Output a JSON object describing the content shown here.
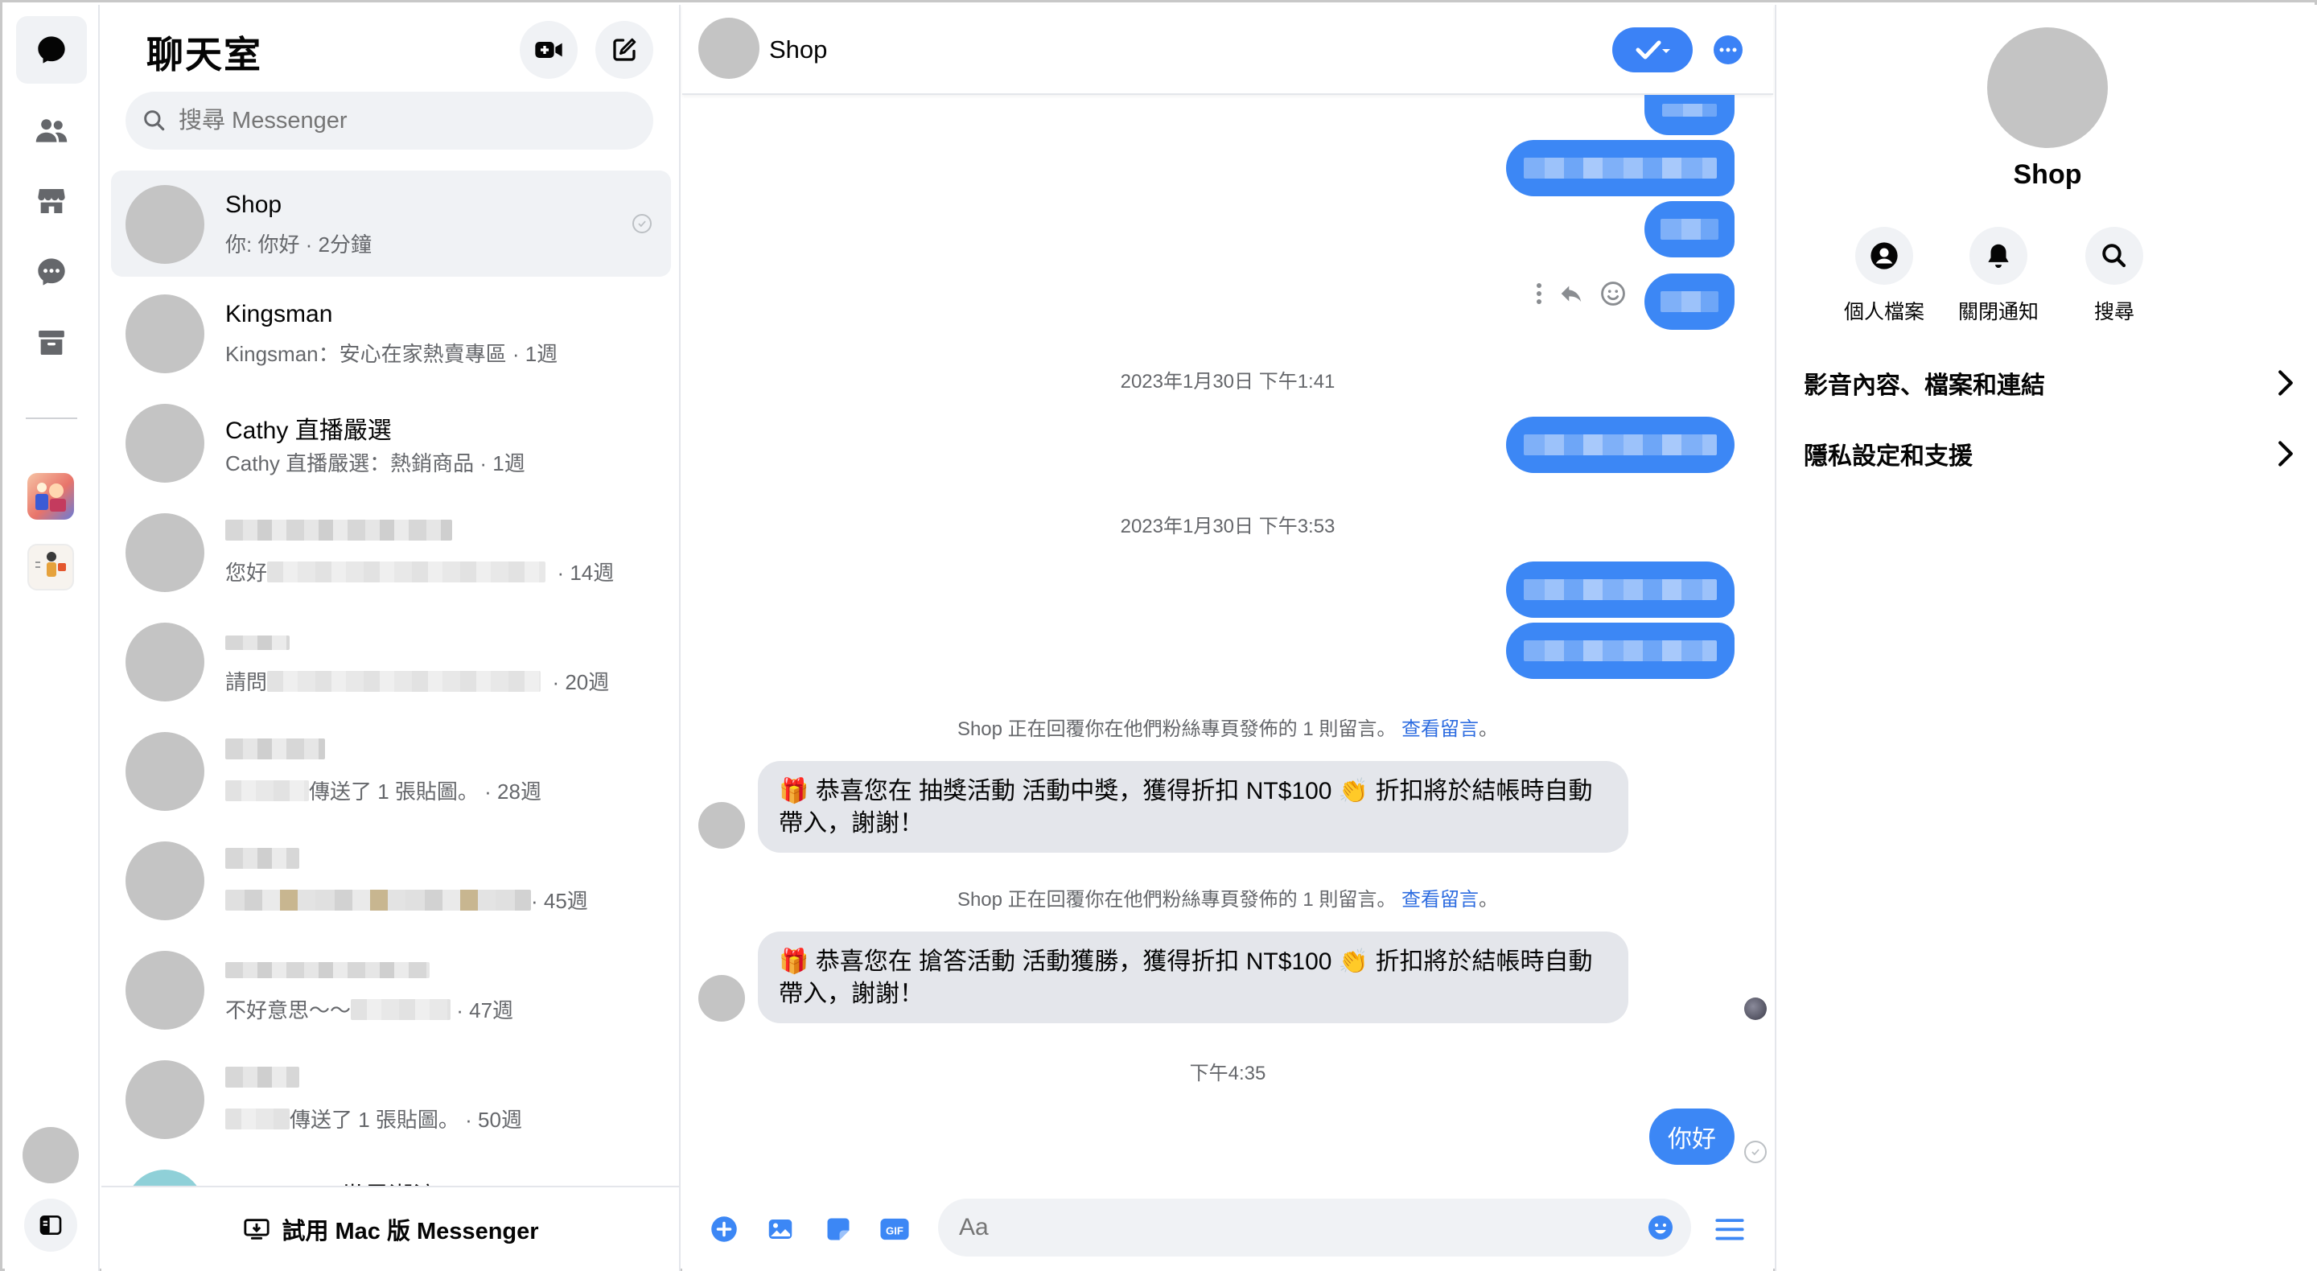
{
  "rail": {
    "items": [
      {
        "name": "chats",
        "icon": "chat-bubble-icon",
        "active": true
      },
      {
        "name": "people",
        "icon": "people-icon"
      },
      {
        "name": "marketplace",
        "icon": "store-icon"
      },
      {
        "name": "requests",
        "icon": "message-dots-icon"
      },
      {
        "name": "archive",
        "icon": "archive-icon"
      }
    ]
  },
  "chatlist": {
    "title": "聊天室",
    "search_placeholder": "搜尋 Messenger",
    "items": [
      {
        "name": "Shop",
        "preview": "你: 你好 · 2分鐘",
        "selected": true
      },
      {
        "name": "Kingsman",
        "preview": "Kingsman：安心在家熱賣專區 · 1週"
      },
      {
        "name": "Cathy 直播嚴選",
        "preview": "Cathy 直播嚴選：熱銷商品 · 1週"
      },
      {
        "preview_prefix": "您好",
        "time": "· 14週"
      },
      {
        "preview_prefix": "請問",
        "time": "· 20週"
      },
      {
        "preview_prefix": "傳送了 1 張貼圖。",
        "time": "· 28週"
      },
      {
        "preview_prefix": "",
        "time": "· 45週"
      },
      {
        "preview_prefix": "不好意思～～",
        "time": "· 47週"
      },
      {
        "preview_prefix": "傳送了 1 張貼圖。",
        "time": "· 50週"
      },
      {
        "name": "Shopline · 世界潮流"
      }
    ],
    "footer": "試用 Mac 版 Messenger"
  },
  "conversation": {
    "name": "Shop",
    "timestamps": [
      "2023年1月30日 下午1:41",
      "2023年1月30日 下午3:53",
      "下午4:35"
    ],
    "system_messages": [
      {
        "text": "Shop 正在回覆你在他們粉絲專頁發佈的 1 則留言。",
        "link": "查看留言",
        "period": "。"
      },
      {
        "text": "Shop 正在回覆你在他們粉絲專頁發佈的 1 則留言。",
        "link": "查看留言",
        "period": "。"
      }
    ],
    "incoming": [
      {
        "icon": "🎁",
        "text_a": "恭喜您在 抽獎活動 活動中獎，獲得折扣 NT$100",
        "clap": "👏",
        "text_b": "折扣將於結帳時自動",
        "line2": "帶入，謝謝！"
      },
      {
        "icon": "🎁",
        "text_a": "恭喜您在 搶答活動 活動獲勝，獲得折扣 NT$100",
        "clap": "👏",
        "text_b": "折扣將於結帳時自動",
        "line2": "帶入，謝謝！"
      }
    ],
    "last_outgoing": "你好",
    "composer_placeholder": "Aa",
    "accent": "#3c87f5"
  },
  "info": {
    "name": "Shop",
    "actions": [
      {
        "label": "個人檔案",
        "icon": "profile-icon"
      },
      {
        "label": "關閉通知",
        "icon": "bell-icon"
      },
      {
        "label": "搜尋",
        "icon": "search-icon"
      }
    ],
    "rows": [
      "影音內容、檔案和連結",
      "隱私設定和支援"
    ]
  }
}
